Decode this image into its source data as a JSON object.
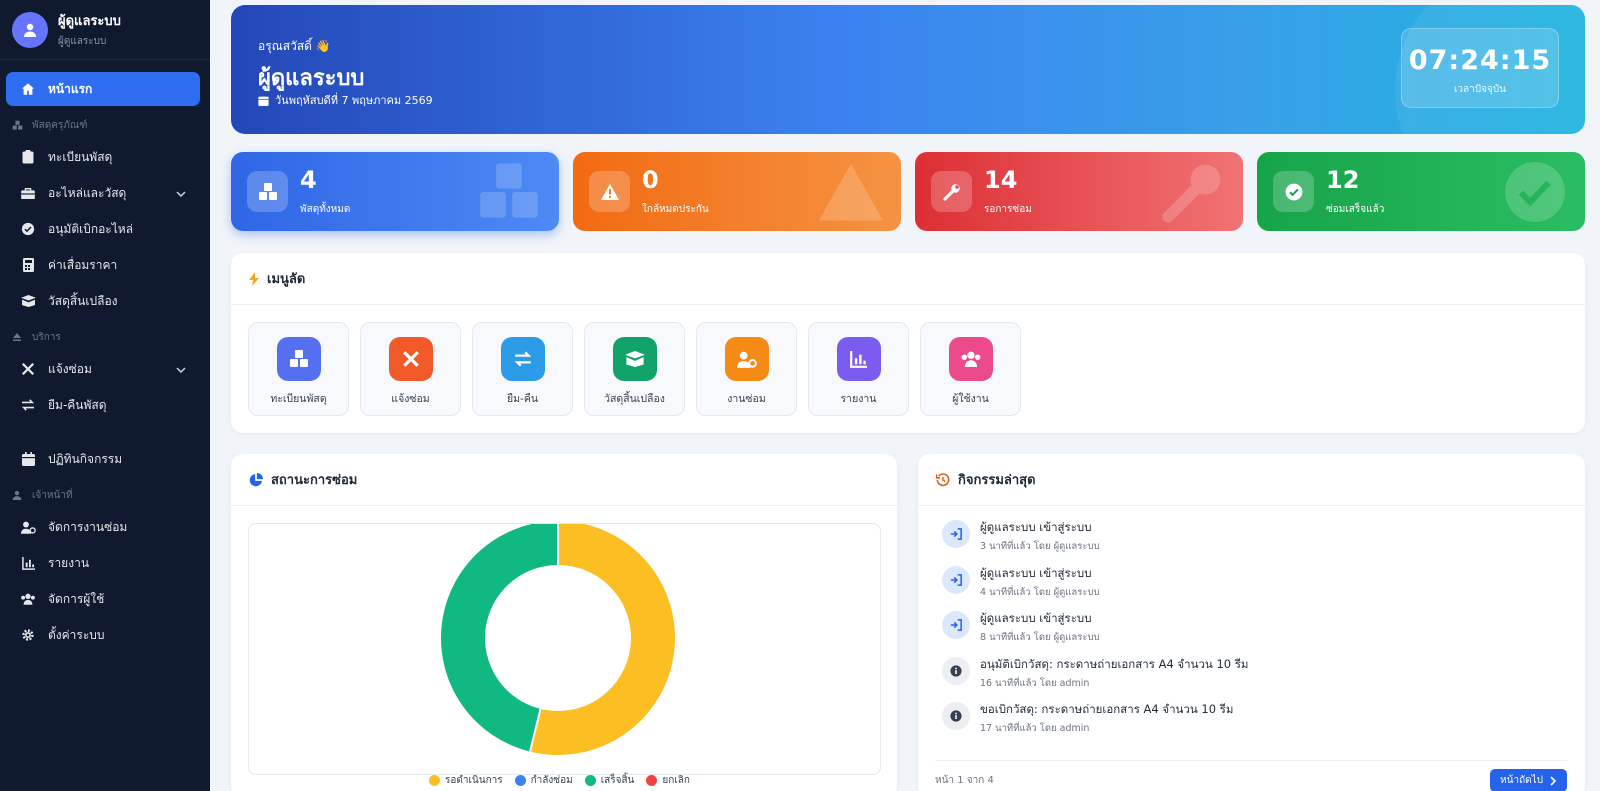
{
  "sidebar": {
    "profile": {
      "name": "ผู้ดูแลระบบ",
      "role": "ผู้ดูแลระบบ"
    },
    "items": [
      {
        "label": "หน้าแรก",
        "icon": "home-icon",
        "active": true
      },
      {
        "section": "พัสดุครุภัณฑ์",
        "icon": "boxes-icon"
      },
      {
        "label": "ทะเบียนพัสดุ",
        "icon": "clipboard-icon"
      },
      {
        "label": "อะไหล่และวัสดุ",
        "icon": "toolbox-icon",
        "expandable": true
      },
      {
        "label": "อนุมัติเบิกอะไหล่",
        "icon": "check-circle-icon"
      },
      {
        "label": "ค่าเสื่อมราคา",
        "icon": "calculator-icon"
      },
      {
        "label": "วัสดุสิ้นเปลือง",
        "icon": "box-open-icon"
      },
      {
        "section": "บริการ",
        "icon": "eject-icon"
      },
      {
        "label": "แจ้งซ่อม",
        "icon": "tools-icon",
        "expandable": true
      },
      {
        "label": "ยืม-คืนพัสดุ",
        "icon": "exchange-icon"
      },
      {
        "label": "ปฏิทินกิจกรรม",
        "icon": "calendar-icon"
      },
      {
        "section": "เจ้าหน้าที่",
        "icon": "user-icon"
      },
      {
        "label": "จัดการงานซ่อม",
        "icon": "user-gear-icon"
      },
      {
        "label": "รายงาน",
        "icon": "chart-icon"
      },
      {
        "label": "จัดการผู้ใช้",
        "icon": "users-icon"
      },
      {
        "label": "ตั้งค่าระบบ",
        "icon": "gear-icon"
      }
    ]
  },
  "hero": {
    "greeting": "อรุณสวัสดิ์ 👋",
    "title": "ผู้ดูแลระบบ",
    "date": "วันพฤหัสบดีที่ 7 พฤษภาคม 2569",
    "clock_time": "07:24:15",
    "clock_label": "เวลาปัจจุบัน"
  },
  "stats": [
    {
      "value": "4",
      "label": "พัสดุทั้งหมด",
      "icon": "boxes-icon",
      "color": "#2f66e6"
    },
    {
      "value": "0",
      "label": "ใกล้หมดประกัน",
      "icon": "warning-icon",
      "color": "#f26a12"
    },
    {
      "value": "14",
      "label": "รอการซ่อม",
      "icon": "wrench-icon",
      "color": "#dc2f34"
    },
    {
      "value": "12",
      "label": "ซ่อมเสร็จแล้ว",
      "icon": "check-icon",
      "color": "#17a34a"
    }
  ],
  "quick_menu": {
    "title": "เมนูลัด",
    "items": [
      {
        "label": "ทะเบียนพัสดุ",
        "icon": "boxes-icon",
        "color": "#5470f0"
      },
      {
        "label": "แจ้งซ่อม",
        "icon": "tools-icon",
        "color": "#f25a2a"
      },
      {
        "label": "ยืม-คืน",
        "icon": "exchange-icon",
        "color": "#2c9be8"
      },
      {
        "label": "วัสดุสิ้นเปลือง",
        "icon": "box-open-icon",
        "color": "#12a36a"
      },
      {
        "label": "งานซ่อม",
        "icon": "user-gear-icon",
        "color": "#f58a14"
      },
      {
        "label": "รายงาน",
        "icon": "chart-icon",
        "color": "#7c5cf0"
      },
      {
        "label": "ผู้ใช้งาน",
        "icon": "users-icon",
        "color": "#ec4a8a"
      }
    ]
  },
  "repair_status": {
    "title": "สถานะการซ่อม",
    "chart_data": {
      "type": "pie",
      "categories": [
        "รอดำเนินการ",
        "กำลังซ่อม",
        "เสร็จสิ้น",
        "ยกเลิก"
      ],
      "values": [
        14,
        0,
        12,
        0
      ],
      "colors": [
        "#fbbf24",
        "#3b82f6",
        "#10b981",
        "#ef4444"
      ],
      "donut": true,
      "legend": "bottom"
    }
  },
  "activity": {
    "title": "กิจกรรมล่าสุด",
    "items": [
      {
        "title": "ผู้ดูแลระบบ เข้าสู่ระบบ",
        "meta": "3 นาทีที่แล้ว โดย ผู้ดูแลระบบ",
        "icon": "sign-in-icon"
      },
      {
        "title": "ผู้ดูแลระบบ เข้าสู่ระบบ",
        "meta": "4 นาทีที่แล้ว โดย ผู้ดูแลระบบ",
        "icon": "sign-in-icon"
      },
      {
        "title": "ผู้ดูแลระบบ เข้าสู่ระบบ",
        "meta": "8 นาทีที่แล้ว โดย ผู้ดูแลระบบ",
        "icon": "sign-in-icon"
      },
      {
        "title": "อนุมัติเบิกวัสดุ: กระดาษถ่ายเอกสาร A4 จำนวน 10 รีม",
        "meta": "16 นาทีที่แล้ว โดย admin",
        "icon": "info-icon"
      },
      {
        "title": "ขอเบิกวัสดุ: กระดาษถ่ายเอกสาร A4 จำนวน 10 รีม",
        "meta": "17 นาทีที่แล้ว โดย admin",
        "icon": "info-icon"
      }
    ],
    "pager_text": "หน้า 1 จาก 4",
    "next_label": "หน้าถัดไป"
  }
}
